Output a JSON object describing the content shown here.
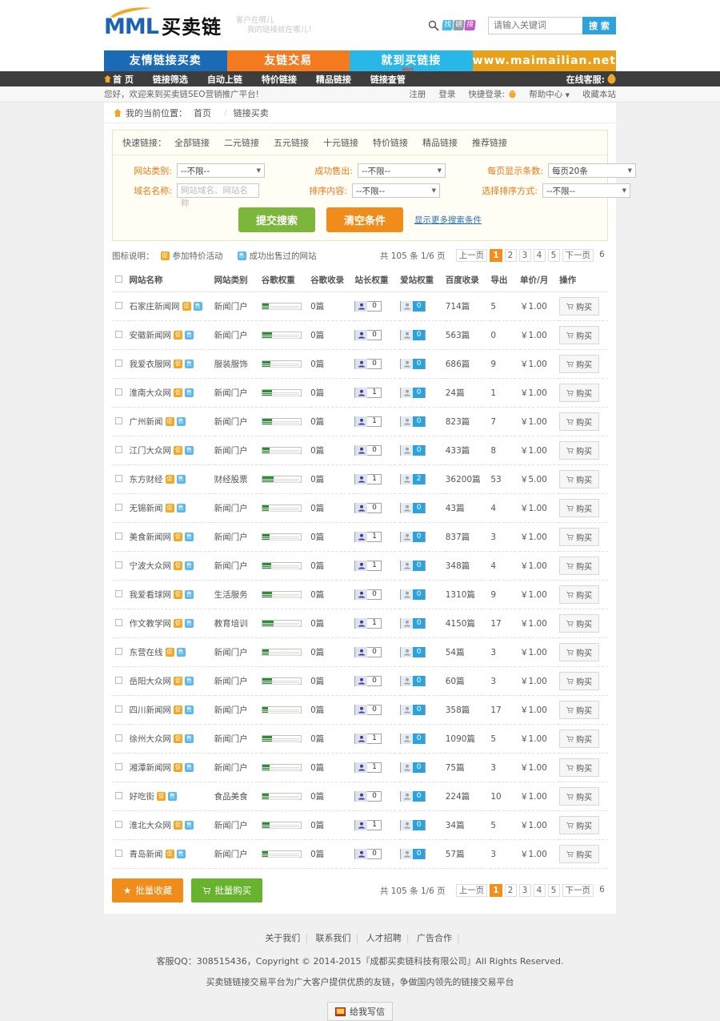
{
  "header": {
    "logo_text": "MML",
    "logo_cn": "买卖链",
    "slogan_line1": "客户在哪儿",
    "slogan_line2": "我的链接就在哪儿！",
    "tiles": [
      "找",
      "链",
      "接"
    ],
    "search_placeholder": "请输入关键词",
    "search_value": "",
    "search_button": "搜 索"
  },
  "banner": [
    {
      "text": "友情链接买卖",
      "color": "#1b6ab5"
    },
    {
      "text": "友链交易",
      "color": "#f47a20"
    },
    {
      "text": "就到买链接",
      "color": "#29b6e8"
    },
    {
      "text": "www.maimailian.net",
      "color": "#e9a11c"
    }
  ],
  "nav": {
    "items": [
      {
        "label": "首 页",
        "badge": ""
      },
      {
        "label": "链接筛选",
        "badge": ""
      },
      {
        "label": "自动上链",
        "badge": ""
      },
      {
        "label": "特价链接",
        "badge": ""
      },
      {
        "label": "精品链接",
        "badge": ""
      },
      {
        "label": "链接查管",
        "badge": "Hot"
      }
    ],
    "service_label": "在线客服:"
  },
  "welcome": {
    "text": "您好，欢迎来到买卖链SEO营销推广平台!",
    "register": "注册",
    "login": "登录",
    "quick_login": "快捷登录:",
    "help_center": "帮助中心",
    "favorite": "收藏本站"
  },
  "breadcrumb": {
    "label": "我的当前位置：",
    "home": "首页",
    "current": "链接买卖"
  },
  "quick_filter": {
    "label": "快速链接：",
    "items": [
      "全部链接",
      "二元链接",
      "五元链接",
      "十元链接",
      "特价链接",
      "精品链接",
      "推荐链接"
    ]
  },
  "form": {
    "site_category_label": "网站类别:",
    "site_category_value": "--不限--",
    "success_sold_label": "成功售出:",
    "success_sold_value": "--不限--",
    "per_page_label": "每页显示条数:",
    "per_page_value": "每页20条",
    "domain_label": "域名名称:",
    "domain_placeholder": "网站域名、网站名称",
    "domain_value": "",
    "sort_content_label": "排序内容:",
    "sort_content_value": "--不限--",
    "sort_method_label": "选择排序方式:",
    "sort_method_value": "--不限--",
    "submit_button": "提交搜索",
    "clear_button": "清空条件",
    "more_link": "显示更多搜索条件"
  },
  "legend": {
    "label": "图标说明：",
    "promo_badge": "促",
    "promo_text": "参加特价活动",
    "sold_badge": "售",
    "sold_text": "成功出售过的网站"
  },
  "pagination": {
    "count_text": "共 105 条 1/6 页",
    "prev": "上一页",
    "pages": [
      "1",
      "2",
      "3",
      "4",
      "5"
    ],
    "active": "1",
    "next": "下一页",
    "last": "6"
  },
  "table": {
    "headers": [
      "网站名称",
      "网站类别",
      "谷歌权重",
      "谷歌收录",
      "站长权重",
      "爱站权重",
      "百度收录",
      "导出",
      "单价/月",
      "操作"
    ],
    "buy_label": "购买",
    "rows": [
      {
        "name": "石家庄新闻网",
        "category": "新闻门户",
        "gweight": 18,
        "gindex": "0篇",
        "zweight": "0",
        "aweight": "0",
        "baidu": "714篇",
        "export": "5",
        "price": "￥1.00"
      },
      {
        "name": "安徽新闻网",
        "category": "新闻门户",
        "gweight": 26,
        "gindex": "0篇",
        "zweight": "0",
        "aweight": "0",
        "baidu": "563篇",
        "export": "0",
        "price": "￥1.00"
      },
      {
        "name": "我爱衣服网",
        "category": "服装服饰",
        "gweight": 22,
        "gindex": "0篇",
        "zweight": "0",
        "aweight": "0",
        "baidu": "686篇",
        "export": "9",
        "price": "￥1.00"
      },
      {
        "name": "淮南大众网",
        "category": "新闻门户",
        "gweight": 26,
        "gindex": "0篇",
        "zweight": "1",
        "aweight": "0",
        "baidu": "24篇",
        "export": "1",
        "price": "￥1.00"
      },
      {
        "name": "广州新闻",
        "category": "新闻门户",
        "gweight": 26,
        "gindex": "0篇",
        "zweight": "1",
        "aweight": "0",
        "baidu": "823篇",
        "export": "7",
        "price": "￥1.00"
      },
      {
        "name": "江门大众网",
        "category": "新闻门户",
        "gweight": 20,
        "gindex": "0篇",
        "zweight": "0",
        "aweight": "0",
        "baidu": "433篇",
        "export": "8",
        "price": "￥1.00"
      },
      {
        "name": "东方财经",
        "category": "财经股票",
        "gweight": 30,
        "gindex": "0篇",
        "zweight": "1",
        "aweight": "2",
        "baidu": "36200篇",
        "export": "53",
        "price": "￥5.00"
      },
      {
        "name": "无锡新闻",
        "category": "新闻门户",
        "gweight": 18,
        "gindex": "0篇",
        "zweight": "0",
        "aweight": "0",
        "baidu": "43篇",
        "export": "4",
        "price": "￥1.00"
      },
      {
        "name": "美食新闻网",
        "category": "新闻门户",
        "gweight": 20,
        "gindex": "0篇",
        "zweight": "1",
        "aweight": "0",
        "baidu": "837篇",
        "export": "3",
        "price": "￥1.00"
      },
      {
        "name": "宁波大众网",
        "category": "新闻门户",
        "gweight": 24,
        "gindex": "0篇",
        "zweight": "1",
        "aweight": "0",
        "baidu": "348篇",
        "export": "4",
        "price": "￥1.00"
      },
      {
        "name": "我爱看球网",
        "category": "生活服务",
        "gweight": 26,
        "gindex": "0篇",
        "zweight": "0",
        "aweight": "0",
        "baidu": "1310篇",
        "export": "9",
        "price": "￥1.00"
      },
      {
        "name": "作文教学网",
        "category": "教育培训",
        "gweight": 30,
        "gindex": "0篇",
        "zweight": "1",
        "aweight": "0",
        "baidu": "4150篇",
        "export": "17",
        "price": "￥1.00"
      },
      {
        "name": "东营在线",
        "category": "新闻门户",
        "gweight": 18,
        "gindex": "0篇",
        "zweight": "0",
        "aweight": "0",
        "baidu": "54篇",
        "export": "3",
        "price": "￥1.00"
      },
      {
        "name": "岳阳大众网",
        "category": "新闻门户",
        "gweight": 26,
        "gindex": "0篇",
        "zweight": "0",
        "aweight": "0",
        "baidu": "60篇",
        "export": "3",
        "price": "￥1.00"
      },
      {
        "name": "四川新闻网",
        "category": "新闻门户",
        "gweight": 16,
        "gindex": "0篇",
        "zweight": "0",
        "aweight": "0",
        "baidu": "358篇",
        "export": "17",
        "price": "￥1.00"
      },
      {
        "name": "徐州大众网",
        "category": "新闻门户",
        "gweight": 26,
        "gindex": "0篇",
        "zweight": "1",
        "aweight": "0",
        "baidu": "1090篇",
        "export": "5",
        "price": "￥1.00"
      },
      {
        "name": "湘潭新闻网",
        "category": "新闻门户",
        "gweight": 20,
        "gindex": "0篇",
        "zweight": "1",
        "aweight": "0",
        "baidu": "75篇",
        "export": "3",
        "price": "￥1.00"
      },
      {
        "name": "好吃街",
        "category": "食品美食",
        "gweight": 18,
        "gindex": "0篇",
        "zweight": "0",
        "aweight": "0",
        "baidu": "224篇",
        "export": "10",
        "price": "￥1.00"
      },
      {
        "name": "淮北大众网",
        "category": "新闻门户",
        "gweight": 20,
        "gindex": "0篇",
        "zweight": "1",
        "aweight": "0",
        "baidu": "34篇",
        "export": "5",
        "price": "￥1.00"
      },
      {
        "name": "青岛新闻",
        "category": "新闻门户",
        "gweight": 16,
        "gindex": "0篇",
        "zweight": "0",
        "aweight": "0",
        "baidu": "57篇",
        "export": "3",
        "price": "￥1.00"
      }
    ]
  },
  "bulk": {
    "favorite_button": "批量收藏",
    "buy_button": "批量购买"
  },
  "footer": {
    "links": [
      "关于我们",
      "联系我们",
      "人才招聘",
      "广告合作"
    ],
    "copyright": "客服QQ：308515436，Copyright © 2014-2015『成都买卖链科技有限公司』All Rights Reserved.",
    "description": "买卖链链接交易平台为广大客户提供优质的友链，争做国内领先的链接交易平台",
    "message_button": "给我写信"
  },
  "colors": {
    "brand_blue": "#1b6ab5",
    "brand_orange": "#f08c1a",
    "brand_green": "#7cb63a",
    "accent_cyan": "#29b6e8",
    "accent_gold": "#e9a11c"
  }
}
